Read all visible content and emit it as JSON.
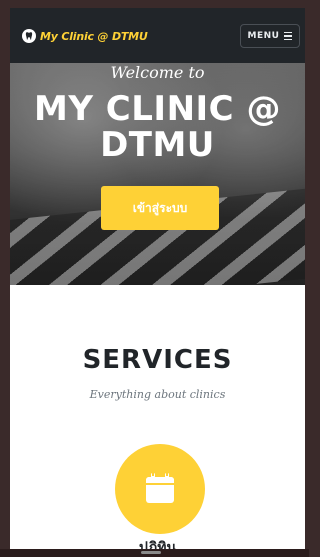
{
  "navbar": {
    "brand_text": "My Clinic @ DTMU",
    "brand_icon": "tooth-icon",
    "menu_label": "MENU",
    "menu_icon": "hamburger-icon"
  },
  "hero": {
    "subheading": "Welcome to",
    "heading_line1": "MY CLINIC @",
    "heading_line2": "DTMU",
    "button_label": "เข้าสู่ระบบ"
  },
  "services": {
    "title": "SERVICES",
    "subtitle": "Everything about clinics",
    "items": [
      {
        "icon": "calendar-icon",
        "label": "ปฏิทิน"
      }
    ]
  },
  "colors": {
    "accent": "#fed136",
    "navbar_bg": "#212529",
    "heading": "#212529",
    "muted": "#6c757d"
  }
}
